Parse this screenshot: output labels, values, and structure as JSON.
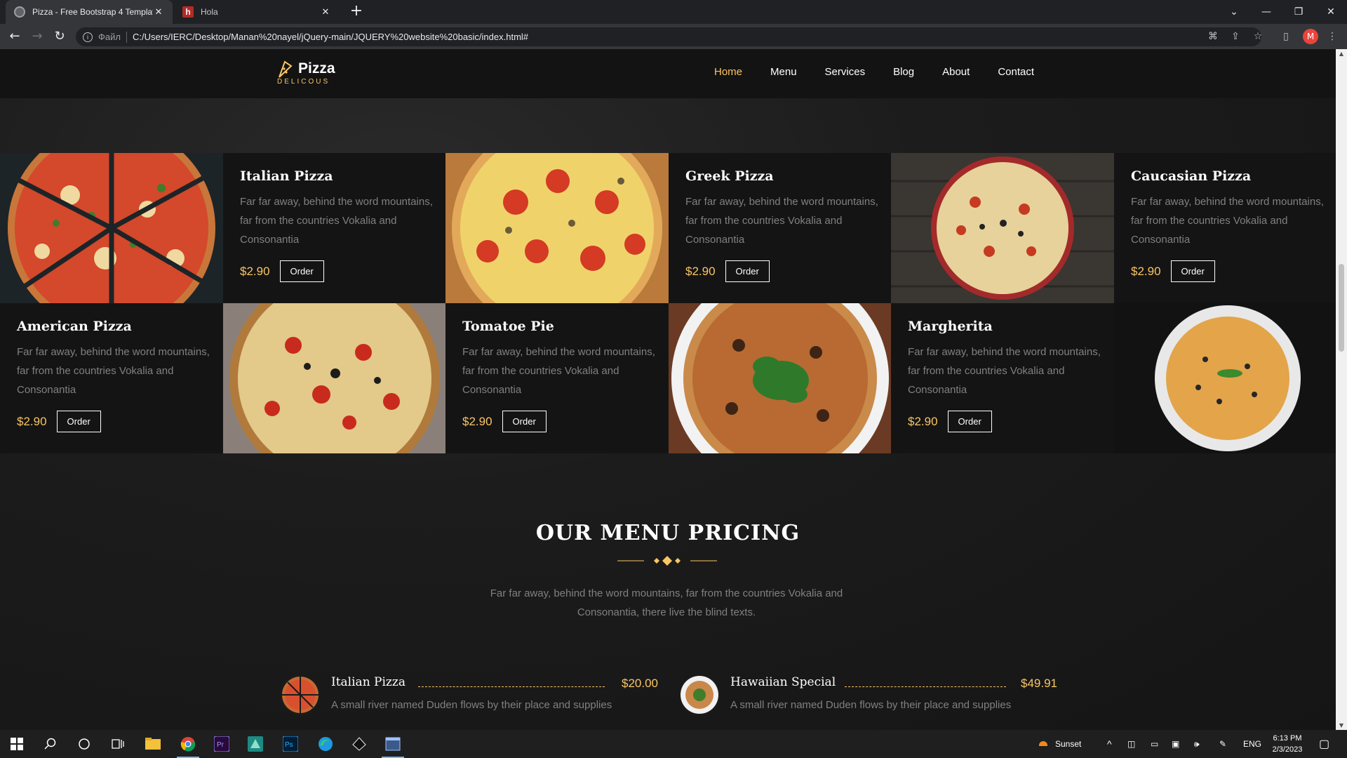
{
  "browser": {
    "tabs": [
      {
        "title": "Pizza - Free Bootstrap 4 Templat",
        "active": true
      },
      {
        "title": "Hola",
        "active": false
      }
    ],
    "address": {
      "scheme": "Файл",
      "url": "C:/Users/IERC/Desktop/Manan%20nayel/jQuery-main/JQUERY%20website%20basic/index.html#"
    },
    "profile_initial": "M"
  },
  "site": {
    "logo": {
      "name": "Pizza",
      "subtitle": "DELICOUS"
    },
    "nav": [
      {
        "label": "Home",
        "active": true
      },
      {
        "label": "Menu",
        "active": false
      },
      {
        "label": "Services",
        "active": false
      },
      {
        "label": "Blog",
        "active": false
      },
      {
        "label": "About",
        "active": false
      },
      {
        "label": "Contact",
        "active": false
      }
    ],
    "pizzas": [
      {
        "name": "Italian Pizza",
        "desc": "Far far away, behind the word mountains, far from the countries Vokalia and Consonantia",
        "price": "$2.90",
        "order": "Order"
      },
      {
        "name": "Greek Pizza",
        "desc": "Far far away, behind the word mountains, far from the countries Vokalia and Consonantia",
        "price": "$2.90",
        "order": "Order"
      },
      {
        "name": "Caucasian Pizza",
        "desc": "Far far away, behind the word mountains, far from the countries Vokalia and Consonantia",
        "price": "$2.90",
        "order": "Order"
      },
      {
        "name": "American Pizza",
        "desc": "Far far away, behind the word mountains, far from the countries Vokalia and Consonantia",
        "price": "$2.90",
        "order": "Order"
      },
      {
        "name": "Tomatoe Pie",
        "desc": "Far far away, behind the word mountains, far from the countries Vokalia and Consonantia",
        "price": "$2.90",
        "order": "Order"
      },
      {
        "name": "Margherita",
        "desc": "Far far away, behind the word mountains, far from the countries Vokalia and Consonantia",
        "price": "$2.90",
        "order": "Order"
      }
    ],
    "pricing": {
      "title": "OUR MENU PRICING",
      "desc": "Far far away, behind the word mountains, far from the countries Vokalia and Consonantia, there live the blind texts.",
      "items": [
        {
          "name": "Italian Pizza",
          "price": "$20.00",
          "desc": "A small river named Duden flows by their place and supplies"
        },
        {
          "name": "Hawaiian Special",
          "price": "$49.91",
          "desc": "A small river named Duden flows by their place and supplies"
        }
      ]
    }
  },
  "taskbar": {
    "weather": "Sunset",
    "lang": "ENG",
    "time": "6:13 PM",
    "date": "2/3/2023"
  },
  "colors": {
    "accent": "#fac564",
    "bg": "#151515"
  }
}
